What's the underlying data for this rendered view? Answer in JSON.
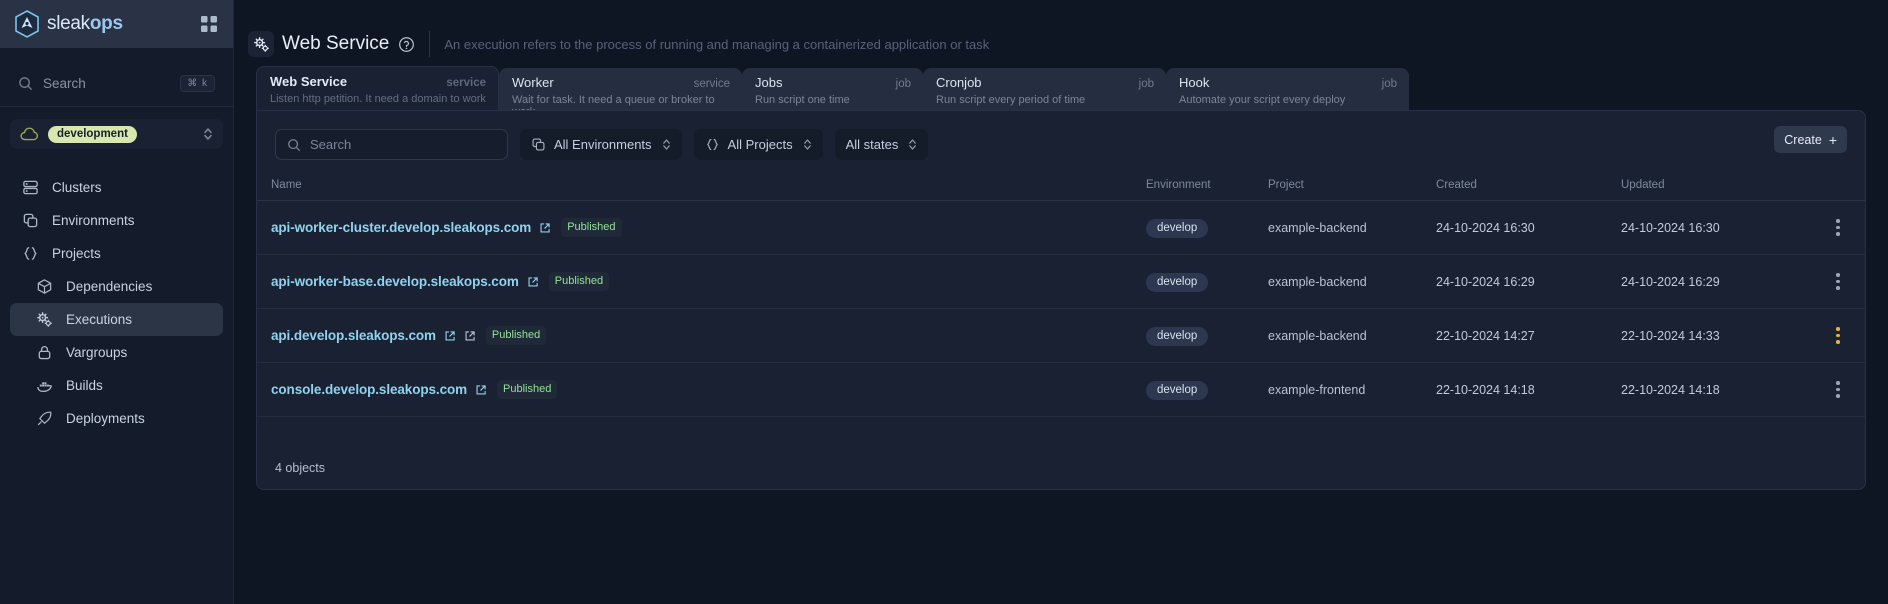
{
  "brand": {
    "name_light": "sleak",
    "name_bold": "ops",
    "grid_icon": "grid-icon",
    "logo_icon": "sleakops-logo-icon"
  },
  "sidebar": {
    "search": {
      "placeholder": "Search",
      "icon": "search-icon",
      "shortcut": "⌘ k"
    },
    "env_selector": {
      "chip": "development",
      "cloud_icon": "cloud-icon",
      "chevron_icon": "chevron-up-down-icon"
    },
    "items": [
      {
        "label": "Clusters",
        "icon": "server-icon",
        "active": false,
        "sub": false
      },
      {
        "label": "Environments",
        "icon": "copy-icon",
        "active": false,
        "sub": false
      },
      {
        "label": "Projects",
        "icon": "braces-icon",
        "active": false,
        "sub": false
      },
      {
        "label": "Dependencies",
        "icon": "cube-icon",
        "active": false,
        "sub": true
      },
      {
        "label": "Executions",
        "icon": "cogs-icon",
        "active": true,
        "sub": true
      },
      {
        "label": "Vargroups",
        "icon": "lock-icon",
        "active": false,
        "sub": true
      },
      {
        "label": "Builds",
        "icon": "docker-icon",
        "active": false,
        "sub": true
      },
      {
        "label": "Deployments",
        "icon": "rocket-icon",
        "active": false,
        "sub": true
      }
    ]
  },
  "header": {
    "icon": "cogs-icon",
    "title": "Web Service",
    "help_icon": "question-circle-icon",
    "subtitle": "An execution refers to the process of running and managing a containerized application or task"
  },
  "tabs": [
    {
      "label": "Web Service",
      "kind": "service",
      "desc": "Listen http petition. It need a domain to work",
      "active": true
    },
    {
      "label": "Worker",
      "kind": "service",
      "desc": "Wait for task. It need a queue or broker to work",
      "active": false
    },
    {
      "label": "Jobs",
      "kind": "job",
      "desc": "Run script one time",
      "active": false
    },
    {
      "label": "Cronjob",
      "kind": "job",
      "desc": "Run script every period of time",
      "active": false
    },
    {
      "label": "Hook",
      "kind": "job",
      "desc": "Automate your script every deploy",
      "active": false
    }
  ],
  "filters": {
    "search": {
      "placeholder": "Search",
      "icon": "search-icon"
    },
    "environments": {
      "label": "All Environments",
      "icon": "copy-icon",
      "chevron_icon": "chevron-up-down-icon"
    },
    "projects": {
      "label": "All Projects",
      "icon": "braces-icon",
      "chevron_icon": "chevron-up-down-icon"
    },
    "states": {
      "label": "All states",
      "chevron_icon": "chevron-up-down-icon"
    },
    "create": {
      "label": "Create",
      "icon": "plus-icon"
    }
  },
  "table": {
    "columns": [
      "Name",
      "Environment",
      "Project",
      "Created",
      "Updated"
    ],
    "rows": [
      {
        "name": "api-worker-cluster.develop.sleakops.com",
        "ext_links": 1,
        "status": "Published",
        "environment": "develop",
        "project": "example-backend",
        "created": "24-10-2024 16:30",
        "updated": "24-10-2024 16:30",
        "menu_state": "default"
      },
      {
        "name": "api-worker-base.develop.sleakops.com",
        "ext_links": 1,
        "status": "Published",
        "environment": "develop",
        "project": "example-backend",
        "created": "24-10-2024 16:29",
        "updated": "24-10-2024 16:29",
        "menu_state": "default"
      },
      {
        "name": "api.develop.sleakops.com",
        "ext_links": 2,
        "status": "Published",
        "environment": "develop",
        "project": "example-backend",
        "created": "22-10-2024 14:27",
        "updated": "22-10-2024 14:33",
        "menu_state": "warning"
      },
      {
        "name": "console.develop.sleakops.com",
        "ext_links": 1,
        "status": "Published",
        "environment": "develop",
        "project": "example-frontend",
        "created": "22-10-2024 14:18",
        "updated": "22-10-2024 14:18",
        "menu_state": "default"
      }
    ],
    "footer": "4 objects"
  },
  "colors": {
    "accent_link": "#8fd3ee",
    "brand": "#9ec9ef",
    "chip_green": "#d7e7ae",
    "status_green": "#96e29a",
    "menu_warning": "#e0b24a"
  }
}
